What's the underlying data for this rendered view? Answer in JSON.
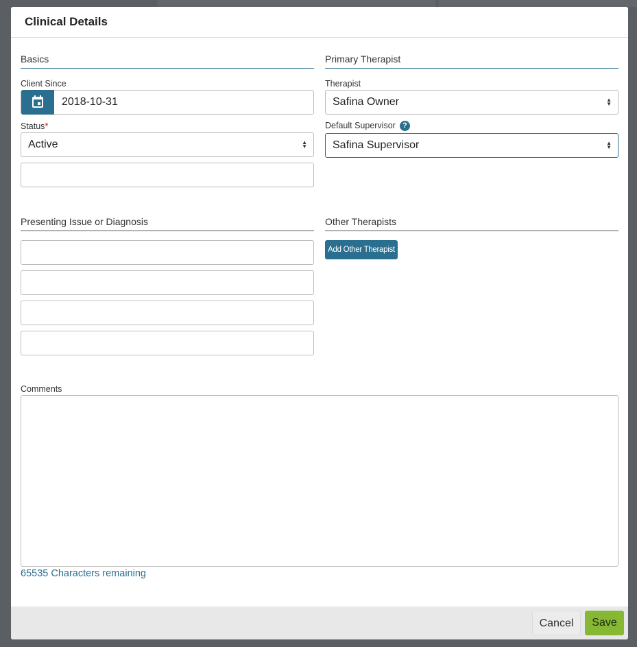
{
  "modal": {
    "title": "Clinical Details"
  },
  "basics": {
    "heading": "Basics",
    "client_since_label": "Client Since",
    "client_since_value": "2018-10-31",
    "status_label": "Status",
    "status_required": "*",
    "status_value": "Active",
    "status_extra_value": ""
  },
  "primary": {
    "heading": "Primary Therapist",
    "therapist_label": "Therapist",
    "therapist_value": "Safina Owner",
    "supervisor_label": "Default Supervisor",
    "supervisor_value": "Safina Supervisor",
    "help": "?"
  },
  "presenting": {
    "heading": "Presenting Issue or Diagnosis",
    "fields": [
      "",
      "",
      "",
      ""
    ]
  },
  "other": {
    "heading": "Other Therapists",
    "add_label": "Add Other Therapist"
  },
  "comments": {
    "label": "Comments",
    "value": "",
    "remaining": "65535 Characters remaining"
  },
  "footer": {
    "cancel": "Cancel",
    "save": "Save"
  },
  "colors": {
    "accent": "#2a6f8f",
    "save": "#86b834"
  }
}
